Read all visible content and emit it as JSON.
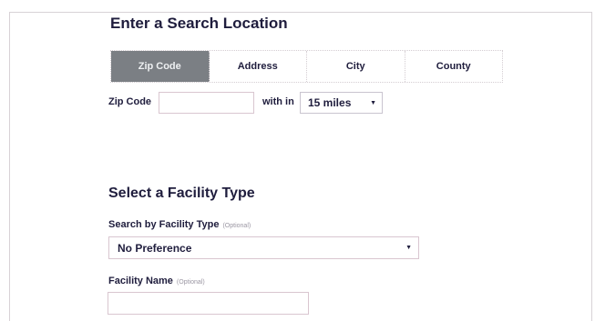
{
  "search_location": {
    "heading": "Enter a Search Location",
    "tabs": [
      {
        "label": "Zip Code",
        "active": true
      },
      {
        "label": "Address",
        "active": false
      },
      {
        "label": "City",
        "active": false
      },
      {
        "label": "County",
        "active": false
      }
    ],
    "zip_label": "Zip Code",
    "zip_value": "",
    "within_label": "with in",
    "radius_selected": "15 miles"
  },
  "facility": {
    "heading": "Select a Facility Type",
    "type_label": "Search by Facility Type",
    "type_optional": "(Optional)",
    "type_selected": "No Preference",
    "name_label": "Facility Name",
    "name_optional": "(Optional)",
    "name_value": ""
  },
  "colors": {
    "active_tab_bg": "#7b7f84",
    "text": "#1f1d3d",
    "input_border": "#d9c6d0"
  }
}
